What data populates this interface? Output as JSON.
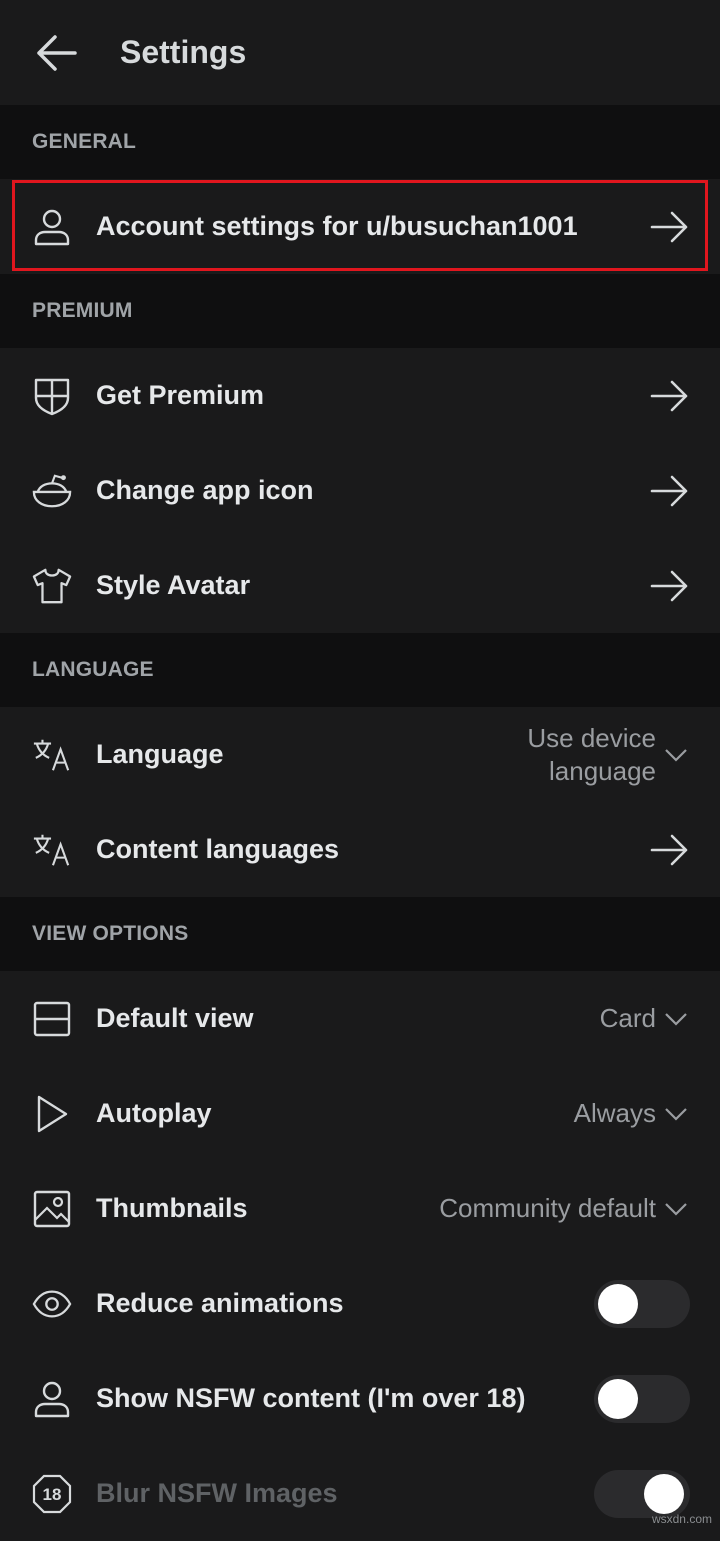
{
  "header": {
    "title": "Settings"
  },
  "sections": {
    "general": "GENERAL",
    "premium": "PREMIUM",
    "language": "LANGUAGE",
    "view_options": "VIEW OPTIONS"
  },
  "rows": {
    "account": "Account settings for u/busuchan1001",
    "premium": "Get Premium",
    "app_icon": "Change app icon",
    "avatar": "Style Avatar",
    "language": "Language",
    "language_value_1": "Use device",
    "language_value_2": "language",
    "content_languages": "Content languages",
    "default_view": "Default view",
    "default_view_value": "Card",
    "autoplay": "Autoplay",
    "autoplay_value": "Always",
    "thumbnails": "Thumbnails",
    "thumbnails_value": "Community default",
    "reduce_animations": "Reduce animations",
    "show_nsfw": "Show NSFW content (I'm over 18)",
    "blur_nsfw": "Blur NSFW Images"
  },
  "toggles": {
    "reduce_animations": false,
    "show_nsfw": false,
    "blur_nsfw": true
  },
  "highlight_color": "#e0161e",
  "watermark": "wsxdn.com"
}
